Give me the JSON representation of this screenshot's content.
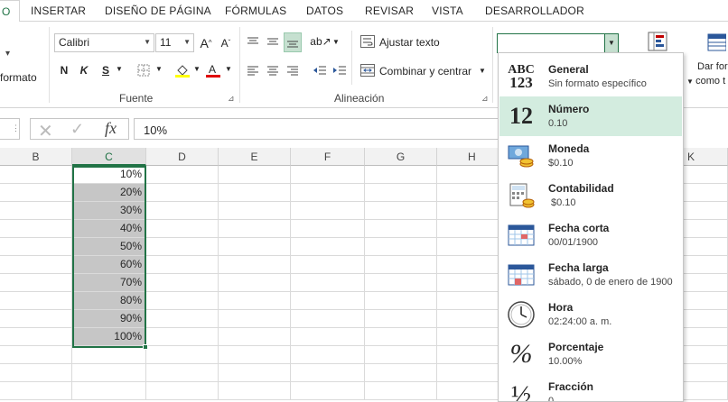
{
  "menu": {
    "tabs": [
      "O",
      "INSERTAR",
      "DISEÑO DE PÁGINA",
      "FÓRMULAS",
      "DATOS",
      "REVISAR",
      "VISTA",
      "DESARROLLADOR"
    ]
  },
  "ribbon": {
    "format_label": "formato",
    "font_name": "Calibri",
    "font_size": "11",
    "bold": "N",
    "italic": "K",
    "underline": "S",
    "font_group": "Fuente",
    "wrap_text": "Ajustar texto",
    "merge_center": "Combinar y centrar",
    "alignment_group": "Alineación",
    "number_format_value": "",
    "dar_formato": "Dar for",
    "como_tabla": "como t"
  },
  "formula_bar": {
    "value": "10%",
    "fx": "fx"
  },
  "columns": [
    "B",
    "C",
    "D",
    "E",
    "F",
    "G",
    "H",
    "K"
  ],
  "cells_c": [
    "10%",
    "20%",
    "30%",
    "40%",
    "50%",
    "60%",
    "70%",
    "80%",
    "90%",
    "100%"
  ],
  "number_formats": [
    {
      "name": "General",
      "sample": "Sin formato específico",
      "icon": "abc-123-icon",
      "glyph_top": "ABC",
      "glyph_bottom": "123"
    },
    {
      "name": "Número",
      "sample": "0.10",
      "icon": "number-icon",
      "glyph": "12"
    },
    {
      "name": "Moneda",
      "sample": "$0.10",
      "icon": "currency-icon"
    },
    {
      "name": "Contabilidad",
      "sample": "$0.10",
      "icon": "accounting-icon"
    },
    {
      "name": "Fecha corta",
      "sample": "00/01/1900",
      "icon": "calendar-short-icon"
    },
    {
      "name": "Fecha larga",
      "sample": "sábado, 0 de enero de 1900",
      "icon": "calendar-long-icon"
    },
    {
      "name": "Hora",
      "sample": "02:24:00 a. m.",
      "icon": "clock-icon"
    },
    {
      "name": "Porcentaje",
      "sample": "10.00%",
      "icon": "percent-icon",
      "glyph": "%"
    },
    {
      "name": "Fracción",
      "sample": "0",
      "icon": "fraction-icon",
      "glyph": "½"
    }
  ],
  "colors": {
    "accent": "#217346",
    "selection_fill": "#c6c6c6",
    "highlight": "#d3ecdf"
  }
}
